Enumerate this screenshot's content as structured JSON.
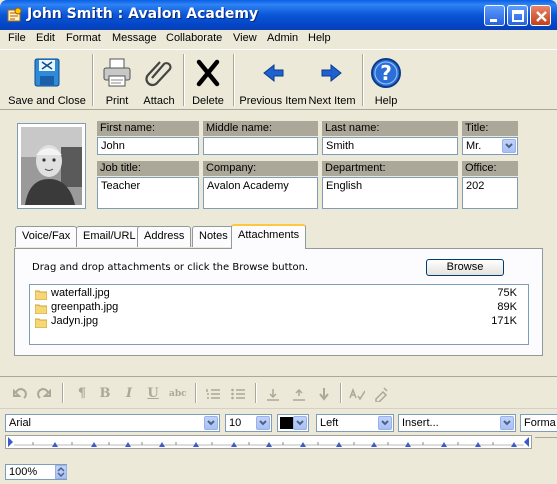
{
  "window": {
    "title": "John Smith : Avalon Academy"
  },
  "menu": [
    "File",
    "Edit",
    "Format",
    "Message",
    "Collaborate",
    "View",
    "Admin",
    "Help"
  ],
  "toolbar": {
    "save_close": "Save and Close",
    "print": "Print",
    "attach": "Attach",
    "delete": "Delete",
    "previous": "Previous Item",
    "next": "Next Item",
    "help": "Help"
  },
  "contact": {
    "first_name_label": "First name:",
    "first_name": "John",
    "middle_name_label": "Middle name:",
    "middle_name": "",
    "last_name_label": "Last name:",
    "last_name": "Smith",
    "title_label": "Title:",
    "title": "Mr.",
    "job_title_label": "Job title:",
    "job_title": "Teacher",
    "company_label": "Company:",
    "company": "Avalon Academy",
    "department_label": "Department:",
    "department": "English",
    "office_label": "Office:",
    "office": "202"
  },
  "tabs": [
    "Voice/Fax",
    "Email/URL",
    "Address",
    "Notes",
    "Attachments"
  ],
  "active_tab": "Attachments",
  "attachments": {
    "hint": "Drag and drop attachments or click the Browse button.",
    "browse_label": "Browse",
    "files": [
      {
        "name": "waterfall.jpg",
        "size": "75K"
      },
      {
        "name": "greenpath.jpg",
        "size": "89K"
      },
      {
        "name": "Jadyn.jpg",
        "size": "171K"
      }
    ]
  },
  "editor": {
    "font": "Arial",
    "size": "10",
    "align": "Left",
    "insert": "Insert...",
    "format": "Forma",
    "zoom": "100%"
  },
  "colors": {
    "titlebar": "#0a56d6",
    "window_bg": "#ece9d8",
    "tab_accent": "#ffc83c",
    "label_bg": "#aca899"
  }
}
